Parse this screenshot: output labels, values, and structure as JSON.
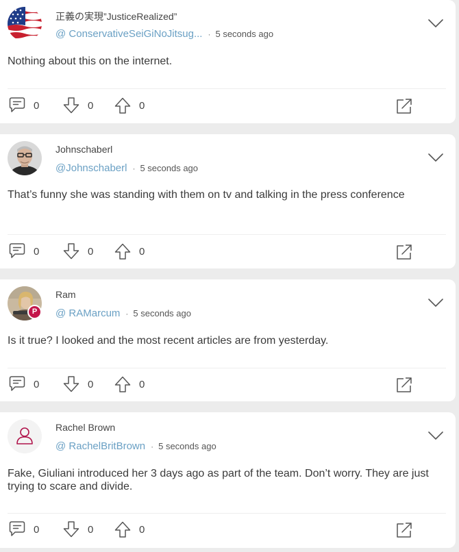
{
  "colors": {
    "handle": "#6aa0c4",
    "badge": "#c4174b",
    "icon": "#555555"
  },
  "icons": {
    "comment": "comment-icon",
    "downvote": "downvote-icon",
    "upvote": "upvote-icon",
    "share": "share-icon",
    "menu": "chevron-down-icon",
    "badge": "parler-badge-icon"
  },
  "posts": [
    {
      "display_name": "正義の実現”JusticeRealized”",
      "handle": "@ ConservativeSeiGiNoJitsug...",
      "separator": "·",
      "time": "5 seconds ago",
      "text": "Nothing about this on the internet.",
      "comments": "0",
      "downvotes": "0",
      "upvotes": "0"
    },
    {
      "display_name": "Johnschaberl",
      "handle": "@Johnschaberl",
      "separator": "·",
      "time": "5 seconds ago",
      "text": "That’s funny she was standing with them on tv and talking in the press conference",
      "comments": "0",
      "downvotes": "0",
      "upvotes": "0"
    },
    {
      "display_name": "Ram",
      "handle": "@ RAMarcum",
      "separator": "·",
      "time": "5 seconds ago",
      "text": "Is it true? I looked and the most recent articles are from yesterday.",
      "comments": "0",
      "downvotes": "0",
      "upvotes": "0",
      "badge": "P"
    },
    {
      "display_name": "Rachel Brown",
      "handle": "@ RachelBritBrown",
      "separator": "·",
      "time": "5 seconds ago",
      "text": "Fake, Giuliani introduced her 3 days ago as part of the team. Don’t worry. They are just trying to scare and divide.",
      "comments": "0",
      "downvotes": "0",
      "upvotes": "0"
    }
  ]
}
